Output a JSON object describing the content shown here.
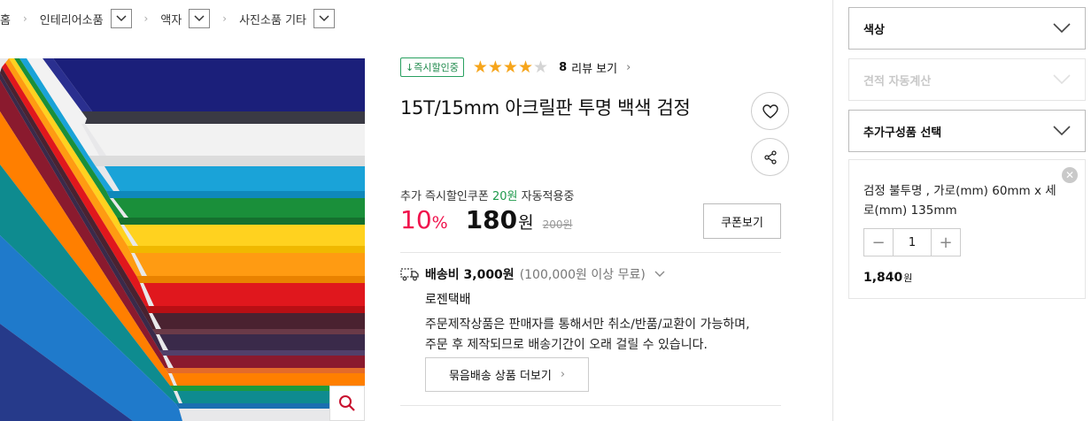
{
  "breadcrumb": {
    "home": "홈",
    "items": [
      {
        "label": "인테리어소품"
      },
      {
        "label": "액자"
      },
      {
        "label": "사진소품 기타"
      }
    ]
  },
  "product": {
    "badge": "↓즉시할인중",
    "rating": 4,
    "rating_max": 5,
    "review_count": "8",
    "review_label": "리뷰 보기",
    "review_chevron": "›",
    "title": "15T/15mm 아크릴판 투명 백색 검정",
    "coupon_prefix": "추가 즉시할인쿠폰",
    "coupon_amount": "20원",
    "coupon_suffix": "자동적용중",
    "discount_rate": "10",
    "discount_unit": "%",
    "price": "180",
    "price_unit": "원",
    "original_price": "200원",
    "coupon_button": "쿠폰보기",
    "shipping_label": "배송비 3,000원",
    "shipping_free": "(100,000원 이상 무료)",
    "courier": "로젠택배",
    "notice_line1": "주문제작상품은 판매자를 통해서만 취소/반품/교환이 가능하며,",
    "notice_line2": "주문 후 제작되므로 배송기간이 오래 걸릴 수 있습니다.",
    "bundle_button": "묶음배송 상품 더보기",
    "bundle_chevron": "›"
  },
  "options": {
    "color": "색상",
    "estimate": "견적 자동계산",
    "addon": "추가구성품 선택"
  },
  "selected_item": {
    "description": "검정 불투명 , 가로(mm) 60mm x 세로(mm) 135mm",
    "quantity": "1",
    "price": "1,840",
    "price_unit": "원",
    "minus": "−",
    "plus": "+",
    "remove": "✕"
  },
  "icons": {
    "heart": "heart-icon",
    "share": "share-icon",
    "zoom": "search-icon",
    "truck": "truck-icon"
  },
  "colors": {
    "discount": "#f0134d",
    "star": "#f6a51b",
    "coupon_green": "#1f9a4c"
  }
}
